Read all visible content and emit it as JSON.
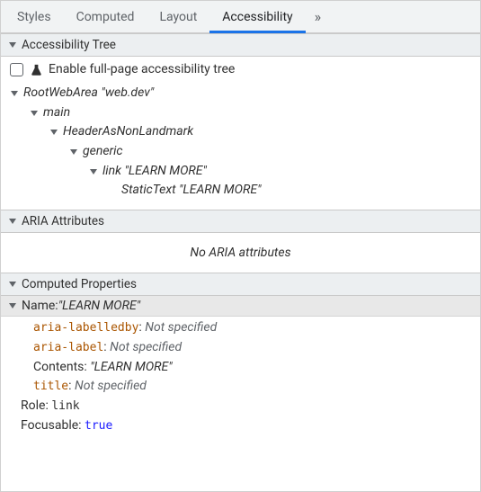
{
  "tabs": {
    "styles": "Styles",
    "computed": "Computed",
    "layout": "Layout",
    "accessibility": "Accessibility",
    "overflow": "»"
  },
  "sections": {
    "tree_header": "Accessibility Tree",
    "aria_header": "ARIA Attributes",
    "computed_header": "Computed Properties"
  },
  "enable_row": {
    "label": "Enable full-page accessibility tree"
  },
  "tree": {
    "root_role": "RootWebArea",
    "root_name": "web.dev",
    "main": "main",
    "header": "HeaderAsNonLandmark",
    "generic": "generic",
    "link_role": "link",
    "link_name": "LEARN MORE",
    "static_role": "StaticText",
    "static_name": "LEARN MORE"
  },
  "aria": {
    "none": "No ARIA attributes"
  },
  "computed": {
    "name_label": "Name: ",
    "name_value": "LEARN MORE",
    "aria_labelledby": "aria-labelledby",
    "aria_label": "aria-label",
    "contents_label": "Contents: ",
    "contents_value": "LEARN MORE",
    "title_attr": "title",
    "not_specified": "Not specified",
    "role_label": "Role: ",
    "role_value": "link",
    "focusable_label": "Focusable: ",
    "focusable_value": "true"
  }
}
